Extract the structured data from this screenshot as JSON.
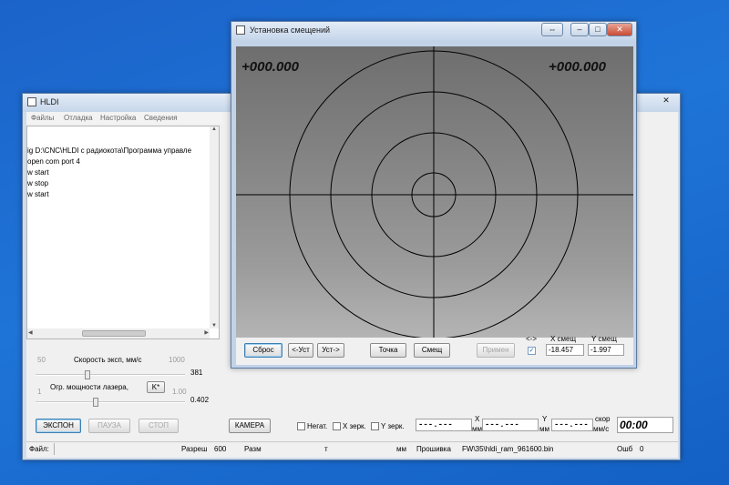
{
  "main_window": {
    "title": "HLDI",
    "menu": [
      "Файлы",
      "Отладка",
      "Настройка",
      "Сведения"
    ],
    "log_lines": [
      "ig D:\\CNC\\HLDI с радиокота\\Программа управле",
      " open com port 4",
      "w start",
      "w stop",
      "w start"
    ],
    "speed": {
      "label": "Скорость эксп, мм/с",
      "min": "50",
      "max": "1000",
      "value": "381",
      "fraction": 0.34
    },
    "power": {
      "label": "Огр. мощности лазера,",
      "k_button": "K*",
      "min": "1",
      "max": "1.00",
      "value": "0.402",
      "fraction": 0.4
    },
    "buttons": {
      "expose": "ЭКСПОН",
      "pause": "ПАУЗА",
      "stop": "СТОП",
      "camera": "КАМЕРА"
    },
    "checkboxes": {
      "negative": "Негат.",
      "x_mirror": "X зерк.",
      "y_mirror": "Y зерк."
    },
    "coords": {
      "x_value": "---.---",
      "x_label": "X",
      "x_unit": "мм",
      "y_value": "---.---",
      "y_label": "Y",
      "y_unit": "мм",
      "speed_value": "---.---",
      "speed_label": "скор",
      "speed_unit": "мм/с",
      "timer": "00:00"
    },
    "status": {
      "file_label": "Файл:",
      "res_label": "Разреш",
      "res_value": "600",
      "size_label": "Разм",
      "size_t": "т",
      "size_unit": "мм",
      "fw_label": "Прошивка",
      "fw_value": "FW\\35\\hldi_ram_961600.bin",
      "err_label": "Ошб",
      "err_value": "0"
    }
  },
  "offset_window": {
    "title": "Установка смещений",
    "overlay_left": "+000.000",
    "overlay_right": "+000.000",
    "buttons": {
      "reset": "Сброс",
      "set_left": "<-Уст",
      "set_right": "Уст->",
      "point": "Точка",
      "shift": "Смещ",
      "apply": "Примен"
    },
    "swap_label": "<->",
    "x_label": "X смещ",
    "y_label": "Y смещ",
    "x_value": "-18.457",
    "y_value": "-1.997"
  }
}
